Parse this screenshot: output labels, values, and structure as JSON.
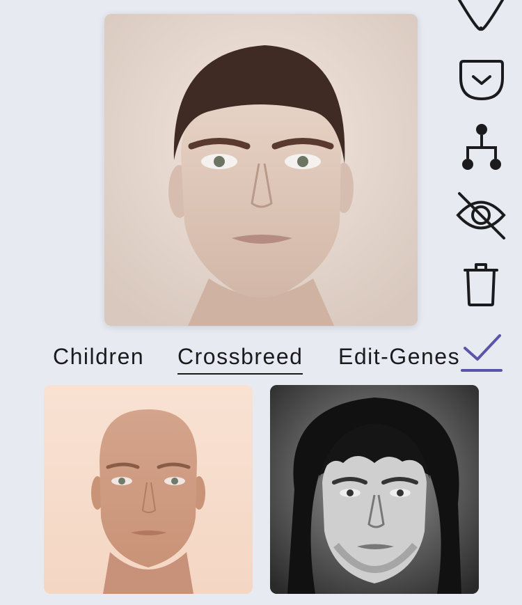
{
  "colors": {
    "background": "#e8eaf2",
    "icon": "#1b1b1d",
    "accent": "#5a55a8"
  },
  "tabs": {
    "children": "Children",
    "crossbreed": "Crossbreed",
    "edit_genes": "Edit-Genes",
    "active": "crossbreed"
  },
  "sidebar": {
    "icons": [
      "heart-icon",
      "pocket-save-icon",
      "family-tree-icon",
      "eye-off-icon",
      "trash-icon",
      "check-icon"
    ]
  },
  "images": {
    "main": "generated-offspring-portrait",
    "parent_a": "mannequin-head-portrait",
    "parent_b": "long-haired-man-bw-portrait"
  }
}
